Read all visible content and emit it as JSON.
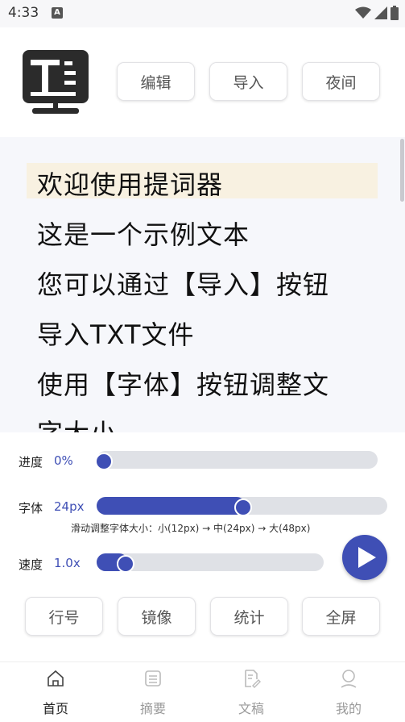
{
  "status": {
    "time": "4:33",
    "notif_badge": "A"
  },
  "header": {
    "buttons": {
      "edit": "编辑",
      "import": "导入",
      "night": "夜间"
    }
  },
  "content": {
    "lines": [
      "欢迎使用提词器",
      "这是一个示例文本",
      "您可以通过【导入】按钮",
      "导入TXT文件",
      "使用【字体】按钮调整文",
      "字大小"
    ],
    "highlight_color": "#f8f1e1"
  },
  "controls": {
    "progress": {
      "label": "进度",
      "value": "0%",
      "fraction": 0.0
    },
    "font": {
      "label": "字体",
      "value": "24px",
      "fraction": 0.5,
      "hint": "滑动调整字体大小：小(12px) → 中(24px) → 大(48px)"
    },
    "speed": {
      "label": "速度",
      "value": "1.0x",
      "fraction": 0.1
    },
    "buttons": {
      "line_no": "行号",
      "mirror": "镜像",
      "stats": "统计",
      "fullscreen": "全屏"
    },
    "accent": "#3f4fb5"
  },
  "nav": {
    "items": [
      {
        "label": "首页",
        "icon": "home-icon",
        "active": true
      },
      {
        "label": "摘要",
        "icon": "summary-icon",
        "active": false
      },
      {
        "label": "文稿",
        "icon": "document-edit-icon",
        "active": false
      },
      {
        "label": "我的",
        "icon": "profile-icon",
        "active": false
      }
    ]
  }
}
